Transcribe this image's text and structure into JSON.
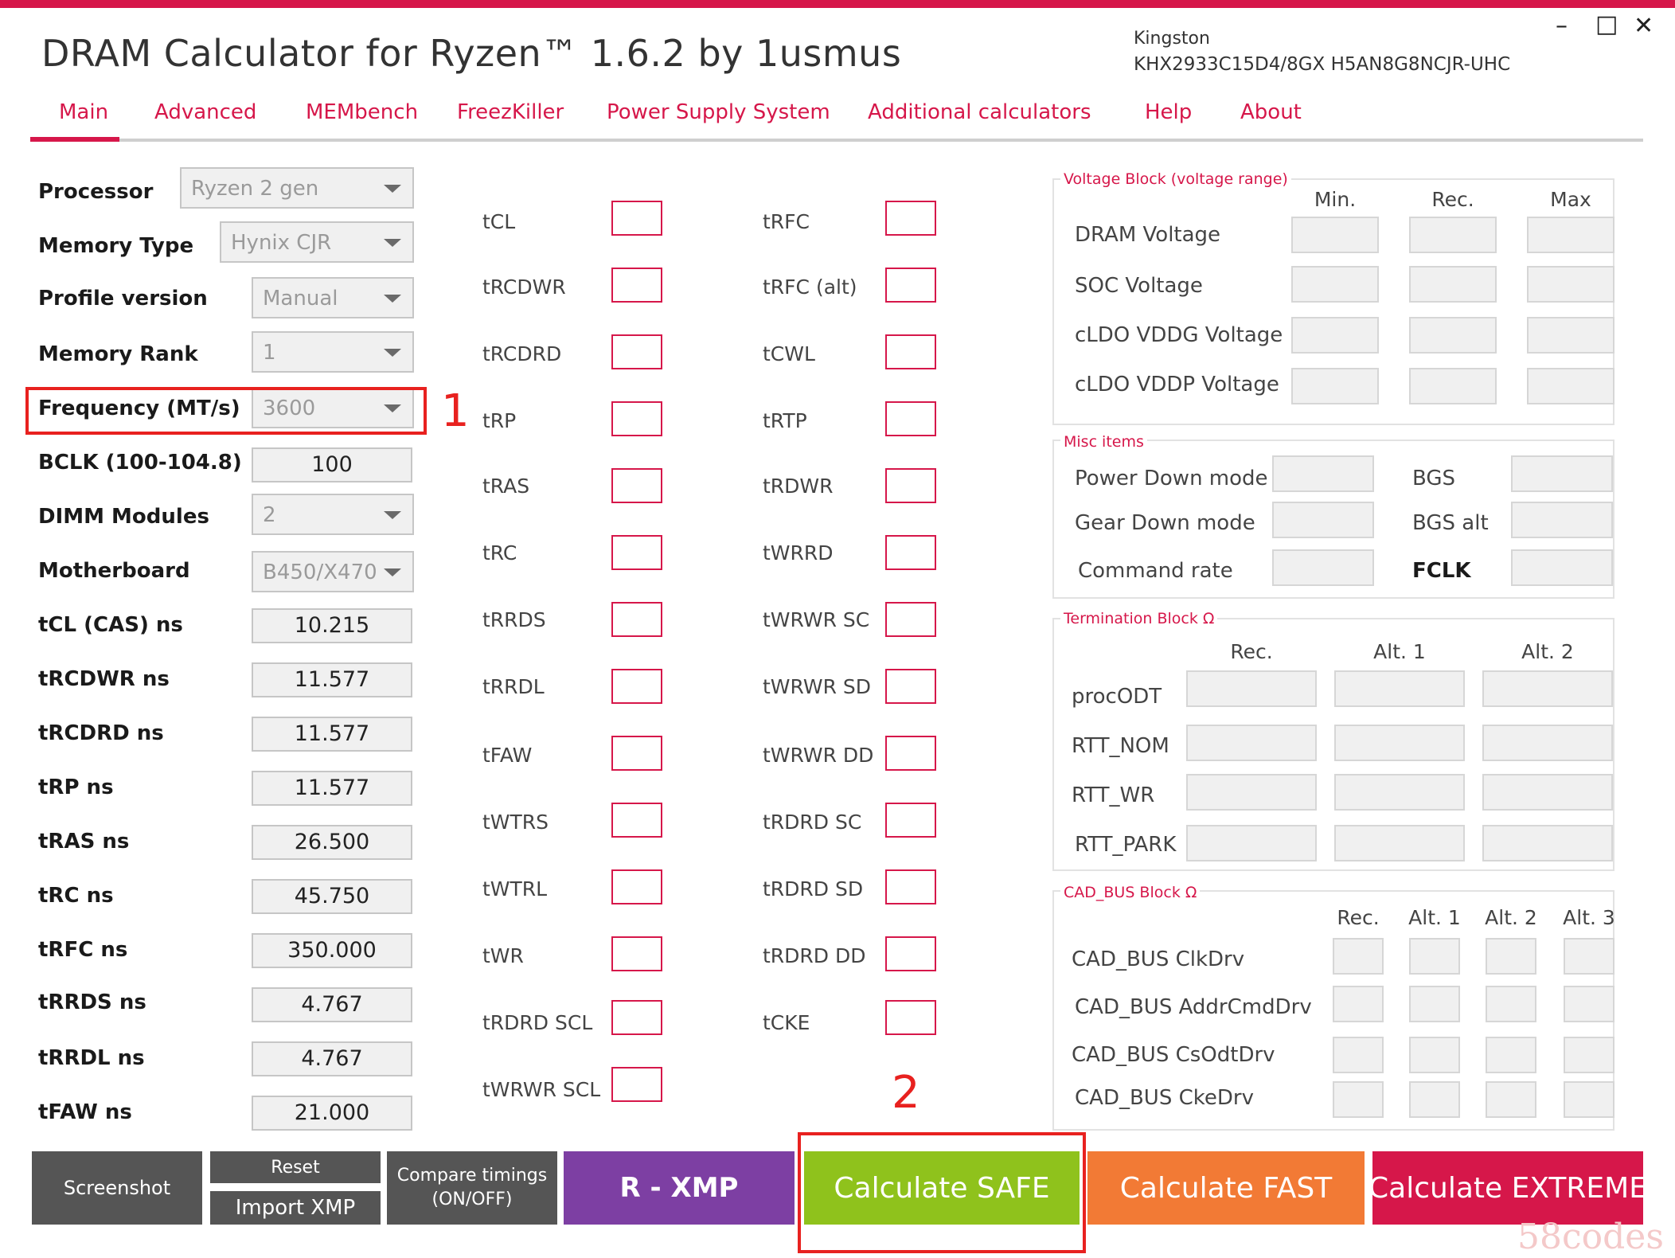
{
  "app": {
    "title": "DRAM Calculator for Ryzen™ 1.6.2 by 1usmus",
    "memory_vendor": "Kingston",
    "memory_module": "KHX2933C15D4/8GX H5AN8G8NCJR-UHC",
    "window_controls": {
      "minimize": "–",
      "maximize": "□",
      "close": "✕"
    }
  },
  "tabs": [
    {
      "label": "Main",
      "active": true
    },
    {
      "label": "Advanced"
    },
    {
      "label": "MEMbench"
    },
    {
      "label": "FreezKiller"
    },
    {
      "label": "Power Supply System"
    },
    {
      "label": "Additional calculators"
    },
    {
      "label": "Help"
    },
    {
      "label": "About"
    }
  ],
  "settings": {
    "processor": {
      "label": "Processor",
      "value": "Ryzen 2 gen"
    },
    "memory_type": {
      "label": "Memory Type",
      "value": "Hynix CJR"
    },
    "profile_version": {
      "label": "Profile version",
      "value": "Manual"
    },
    "memory_rank": {
      "label": "Memory Rank",
      "value": "1"
    },
    "frequency": {
      "label": "Frequency (MT/s)",
      "value": "3600"
    },
    "bclk": {
      "label": "BCLK (100-104.8)",
      "value": "100"
    },
    "dimm_modules": {
      "label": "DIMM Modules",
      "value": "2"
    },
    "motherboard": {
      "label": "Motherboard",
      "value": "B450/X470"
    }
  },
  "ns_values": [
    {
      "label": "tCL (CAS) ns",
      "value": "10.215"
    },
    {
      "label": "tRCDWR ns",
      "value": "11.577"
    },
    {
      "label": "tRCDRD ns",
      "value": "11.577"
    },
    {
      "label": "tRP ns",
      "value": "11.577"
    },
    {
      "label": "tRAS ns",
      "value": "26.500"
    },
    {
      "label": "tRC ns",
      "value": "45.750"
    },
    {
      "label": "tRFC ns",
      "value": "350.000"
    },
    {
      "label": "tRRDS ns",
      "value": "4.767"
    },
    {
      "label": "tRRDL ns",
      "value": "4.767"
    },
    {
      "label": "tFAW ns",
      "value": "21.000"
    }
  ],
  "timings_col1": [
    "tCL",
    "tRCDWR",
    "tRCDRD",
    "tRP",
    "tRAS",
    "tRC",
    "tRRDS",
    "tRRDL",
    "tFAW",
    "tWTRS",
    "tWTRL",
    "tWR",
    "tRDRD SCL",
    "tWRWR SCL"
  ],
  "timings_col2": [
    "tRFC",
    "tRFC (alt)",
    "tCWL",
    "tRTP",
    "tRDWR",
    "tWRRD",
    "tWRWR SC",
    "tWRWR SD",
    "tWRWR DD",
    "tRDRD SC",
    "tRDRD SD",
    "tRDRD DD",
    "tCKE"
  ],
  "voltage_block": {
    "title": "Voltage Block (voltage range)",
    "headers": [
      "Min.",
      "Rec.",
      "Max"
    ],
    "rows": [
      "DRAM Voltage",
      "SOC Voltage",
      "cLDO VDDG Voltage",
      "cLDO VDDP Voltage"
    ]
  },
  "misc_block": {
    "title": "Misc items",
    "left": [
      "Power Down mode",
      "Gear Down mode",
      "Command rate"
    ],
    "right": [
      "BGS",
      "BGS alt",
      "FCLK"
    ]
  },
  "termination_block": {
    "title": "Termination Block Ω",
    "headers": [
      "Rec.",
      "Alt. 1",
      "Alt. 2"
    ],
    "rows": [
      "procODT",
      "RTT_NOM",
      "RTT_WR",
      "RTT_PARK"
    ]
  },
  "cadbus_block": {
    "title": "CAD_BUS Block Ω",
    "headers": [
      "Rec.",
      "Alt. 1",
      "Alt. 2",
      "Alt. 3"
    ],
    "rows": [
      "CAD_BUS ClkDrv",
      "CAD_BUS AddrCmdDrv",
      "CAD_BUS CsOdtDrv",
      "CAD_BUS CkeDrv"
    ]
  },
  "buttons": {
    "screenshot": "Screenshot",
    "reset": "Reset",
    "import_xmp": "Import XMP",
    "compare_line1": "Compare timings",
    "compare_line2": "(ON/OFF)",
    "rxmp": "R - XMP",
    "calc_safe": "Calculate SAFE",
    "calc_fast": "Calculate FAST",
    "calc_extreme": "Calculate EXTREME"
  },
  "annotations": {
    "marker_1": "1",
    "marker_2": "2"
  },
  "watermark": "58codes",
  "colors": {
    "accent": "#d6174a",
    "dark_button": "#555555",
    "rxmp": "#7d3fa3",
    "safe": "#8fc21c",
    "fast": "#f27a35",
    "extreme": "#d6174a",
    "highlight": "#e8211f"
  }
}
